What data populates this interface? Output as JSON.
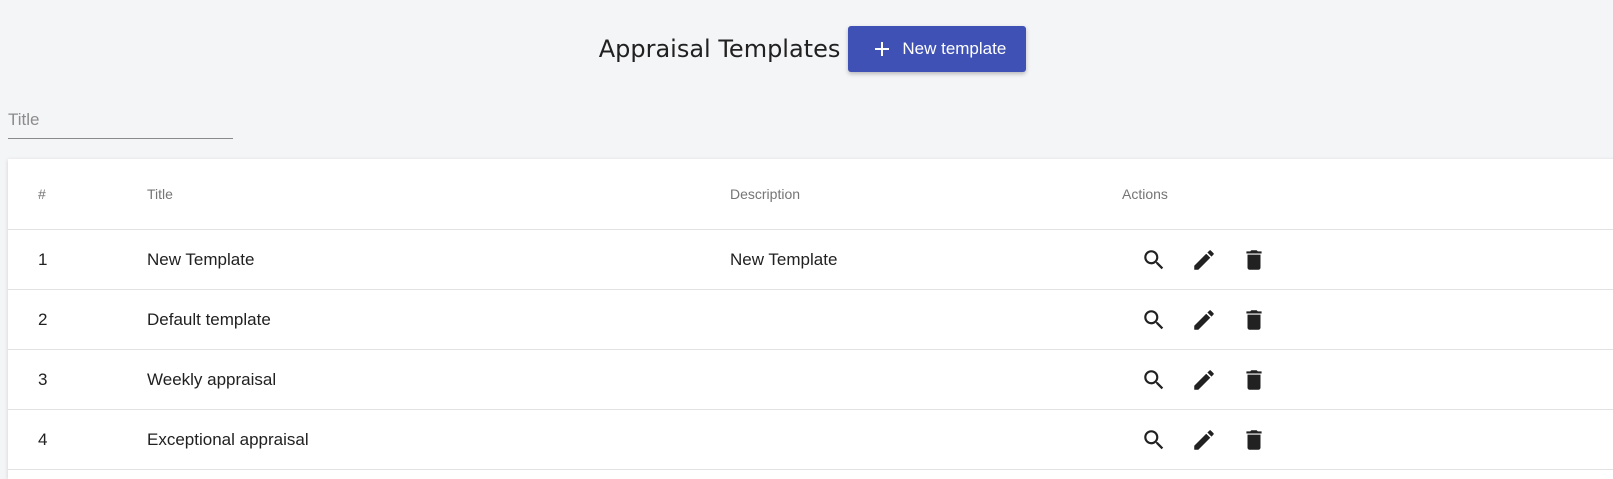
{
  "header": {
    "title": "Appraisal Templates",
    "new_button_label": "New template",
    "new_button_icon": "plus-icon",
    "accent_color": "#3f51b5"
  },
  "filter": {
    "placeholder": "Title",
    "value": ""
  },
  "table": {
    "columns": [
      "#",
      "Title",
      "Description",
      "Actions"
    ],
    "rows": [
      {
        "num": "1",
        "title": "New Template",
        "description": "New Template"
      },
      {
        "num": "2",
        "title": "Default template",
        "description": ""
      },
      {
        "num": "3",
        "title": "Weekly appraisal",
        "description": ""
      },
      {
        "num": "4",
        "title": "Exceptional appraisal",
        "description": ""
      }
    ],
    "row_actions": [
      "view-icon",
      "edit-icon",
      "delete-icon"
    ]
  }
}
